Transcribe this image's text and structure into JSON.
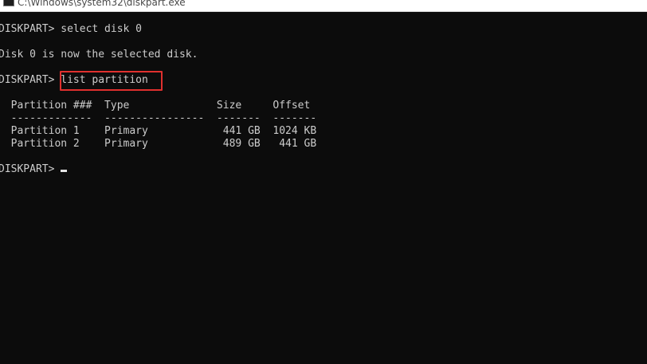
{
  "window": {
    "title": "C:\\Windows\\system32\\diskpart.exe"
  },
  "console": {
    "lines": [
      "DISKPART> select disk 0",
      "",
      "Disk 0 is now the selected disk.",
      "",
      "DISKPART> list partition",
      "",
      "  Partition ###  Type              Size     Offset",
      "  -------------  ----------------  -------  -------",
      "  Partition 1    Primary            441 GB  1024 KB",
      "  Partition 2    Primary            489 GB   441 GB",
      "",
      "DISKPART> "
    ]
  },
  "colors": {
    "background": "#0c0c0c",
    "text": "#cccccc",
    "highlight": "#e0302e"
  }
}
